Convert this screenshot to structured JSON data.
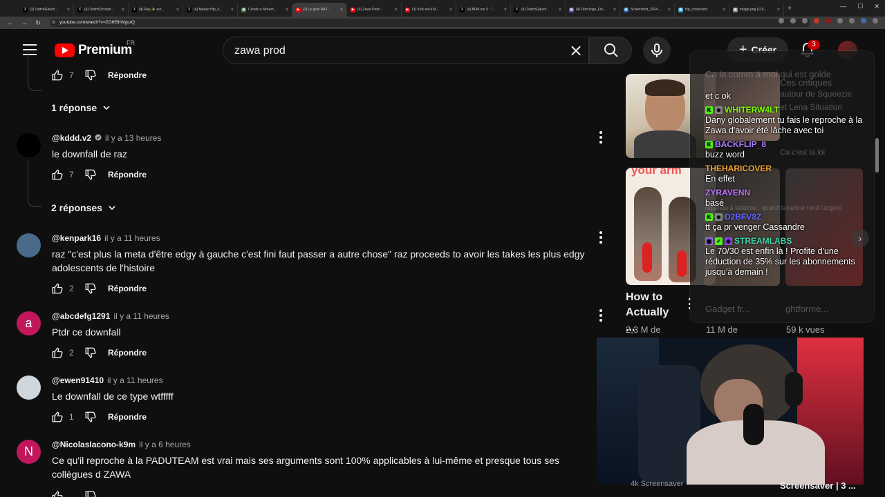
{
  "browser": {
    "tabs": [
      {
        "label": "(3) TwitchGauch...",
        "fav": "X",
        "color": "#000000"
      },
      {
        "label": "(4) TwitchOccitan...",
        "fav": "X",
        "color": "#000000"
      },
      {
        "label": "(4) Ray ✨ sur...",
        "fav": "X",
        "color": "#000000"
      },
      {
        "label": "(4) Madao Hip_0...",
        "fav": "X",
        "color": "#000000"
      },
      {
        "label": "Create a Stream...",
        "fav": "▣",
        "color": "#3a7d44"
      },
      {
        "label": "(3) Le goat RAZ...",
        "fav": "▶",
        "color": "#ff0000"
      },
      {
        "label": "(3) Zawa Prod -",
        "fav": "▶",
        "color": "#ff0000"
      },
      {
        "label": "(3) Kick est-il M...",
        "fav": "▶",
        "color": "#ff0000"
      },
      {
        "label": "(4) BFM sur X : \"...",
        "fav": "X",
        "color": "#000000"
      },
      {
        "label": "(4) TwitchGauch...",
        "fav": "X",
        "color": "#000000"
      },
      {
        "label": "(4) Dom1ngo_Flo...",
        "fav": "▣",
        "color": "#6a4ab0"
      },
      {
        "label": "Screenshot_2024...",
        "fav": "▣",
        "color": "#2a6ab0"
      },
      {
        "label": "fsp_connexion",
        "fav": "▣",
        "color": "#3a9ad8"
      },
      {
        "label": "image.png (119...",
        "fav": "▣",
        "color": "#888888"
      }
    ],
    "active_tab_index": 5,
    "url": "youtube.com/watch?v=ZG6f5hWgurQ",
    "new_tab": "+",
    "window_controls": {
      "min": "—",
      "max": "☐",
      "close": "✕"
    }
  },
  "header": {
    "logo_text": "Premium",
    "region": "FR",
    "search_value": "zawa prod",
    "create_label": "Créer",
    "notif_count": "3"
  },
  "comments": {
    "top_actions": {
      "likes": "7",
      "reply": "Répondre"
    },
    "replies_toggle_1": "1 réponse",
    "replies_toggle_2": "2 réponses",
    "items": [
      {
        "author": "@kddd.v2",
        "verified": true,
        "time": "il y a 13 heures",
        "text": "le downfall de raz",
        "likes": "7",
        "reply": "Répondre",
        "avatar_letter": "",
        "avatar_color": "#000000"
      },
      {
        "author": "@kenpark16",
        "verified": false,
        "time": "il y a 11 heures",
        "text": "raz \"c'est plus la meta d'être edgy à gauche c'est fini faut passer a autre chose\" raz proceeds to avoir les takes les plus edgy adolescents de l'histoire",
        "likes": "2",
        "reply": "Répondre",
        "avatar_letter": "",
        "avatar_color": "#4a6a8a"
      },
      {
        "author": "@abcdefg1291",
        "verified": false,
        "time": "il y a 11 heures",
        "text": "Ptdr ce downfall",
        "likes": "2",
        "reply": "Répondre",
        "avatar_letter": "a",
        "avatar_color": "#c2185b"
      },
      {
        "author": "@ewen91410",
        "verified": false,
        "time": "il y a 11 heures",
        "text": "Le downfall de ce type wtfffff",
        "likes": "1",
        "reply": "Répondre",
        "avatar_letter": "",
        "avatar_color": "#cfd6dc"
      },
      {
        "author": "@NicolasIacono-k9m",
        "verified": false,
        "time": "il y a 6 heures",
        "text": "Ce qu'il reproche à la PADUTEAM est vrai mais ses arguments sont 100% applicables à lui-même et presque tous ses collègues d ZAWA",
        "likes": "",
        "reply": "",
        "avatar_letter": "N",
        "avatar_color": "#c2185b"
      }
    ]
  },
  "recommendations": [
    {
      "thumb_text": "",
      "title": "",
      "meta": ""
    },
    {
      "thumb_text": "your arm",
      "title": "How to Actually ...",
      "meta": "2,3 M de"
    },
    {
      "title": "",
      "meta": "11 M de"
    },
    {
      "title": "",
      "meta": "59 k vues"
    }
  ],
  "bottom_titles": {
    "left": "4k Screensaver",
    "right": "Screensaver | 3 ..."
  },
  "chat": {
    "ghost_lines": [
      "Ca la comm à moi qui est golde",
      "Ces critiques",
      "autour de Squeezie",
      "et Lena Situation",
      "Ca c'est la loi",
      "répondu à salazoo : quand la kelline rend l'argent",
      "et le me doit tqt",
      "Gadget fr...",
      "ghtforme..."
    ],
    "messages": [
      {
        "user": "",
        "text": "et c ok",
        "color": "#ffffff",
        "badges": []
      },
      {
        "user": "WHITERW4LT",
        "text": "Dany globalement tu fais le reproche à la Zawa d'avoir été lâche avec toi",
        "color": "#7cfc00",
        "badges": [
          "K",
          "☻"
        ]
      },
      {
        "user": "BACKFLIP_8",
        "text": "buzz word",
        "color": "#b07cff",
        "badges": [
          "K"
        ]
      },
      {
        "user": "THEHARICOVER",
        "text": "En effet",
        "color": "#f0a030",
        "badges": []
      },
      {
        "user": "ZYRAVENN",
        "text": "basé",
        "color": "#c070ff",
        "badges": []
      },
      {
        "user": "D2BFV8Z",
        "text": "tt ça pr venger Cassandre",
        "color": "#6060ff",
        "badges": [
          "K",
          "☻"
        ]
      },
      {
        "user": "STREAMLABS",
        "text": "Le 70/30 est enfin là ! Profite d'une réduction de 35% sur les abonnements jusqu'à demain !",
        "color": "#3dd9a8",
        "badges": [
          "▣",
          "✓",
          "◆"
        ]
      }
    ],
    "next": "›"
  }
}
